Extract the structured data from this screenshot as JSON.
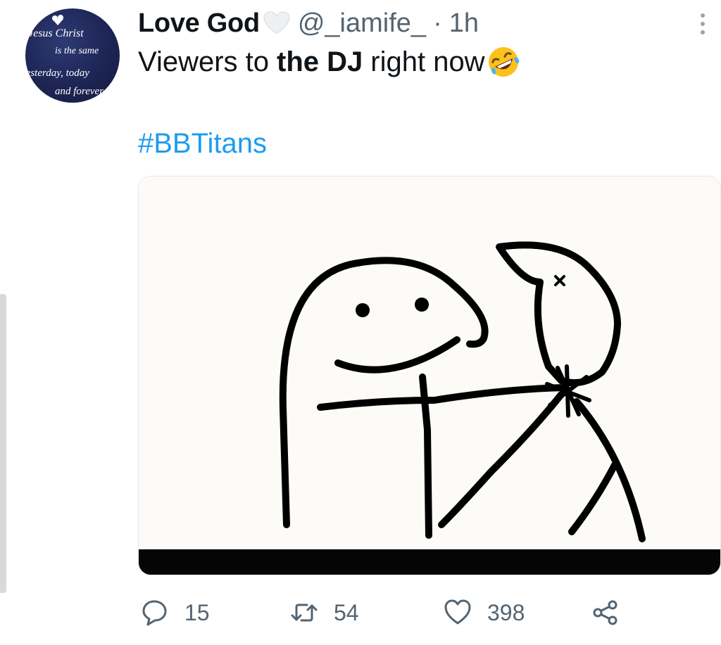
{
  "tweet": {
    "display_name": "Love God",
    "handle": "@_iamife_",
    "separator": "·",
    "time": "1h",
    "text_before": "Viewers to",
    "text_bold": "the DJ",
    "text_after": "right now",
    "emoji": "rolling-on-floor-laughing",
    "hashtag": "#BBTitans",
    "avatar_text": [
      "Jesus Christ",
      "is the same",
      "yesterday, today",
      "and forever"
    ],
    "media": "stick-figure-meme"
  },
  "actions": {
    "replies": "15",
    "retweets": "54",
    "likes": "398"
  },
  "colors": {
    "text": "#0f1419",
    "secondary": "#536471",
    "link": "#1d9bf0",
    "avatar_bg": "#1d2554"
  },
  "icons": [
    "more-vertical-icon",
    "reply-icon",
    "retweet-icon",
    "like-icon",
    "share-icon",
    "white-heart-icon"
  ]
}
